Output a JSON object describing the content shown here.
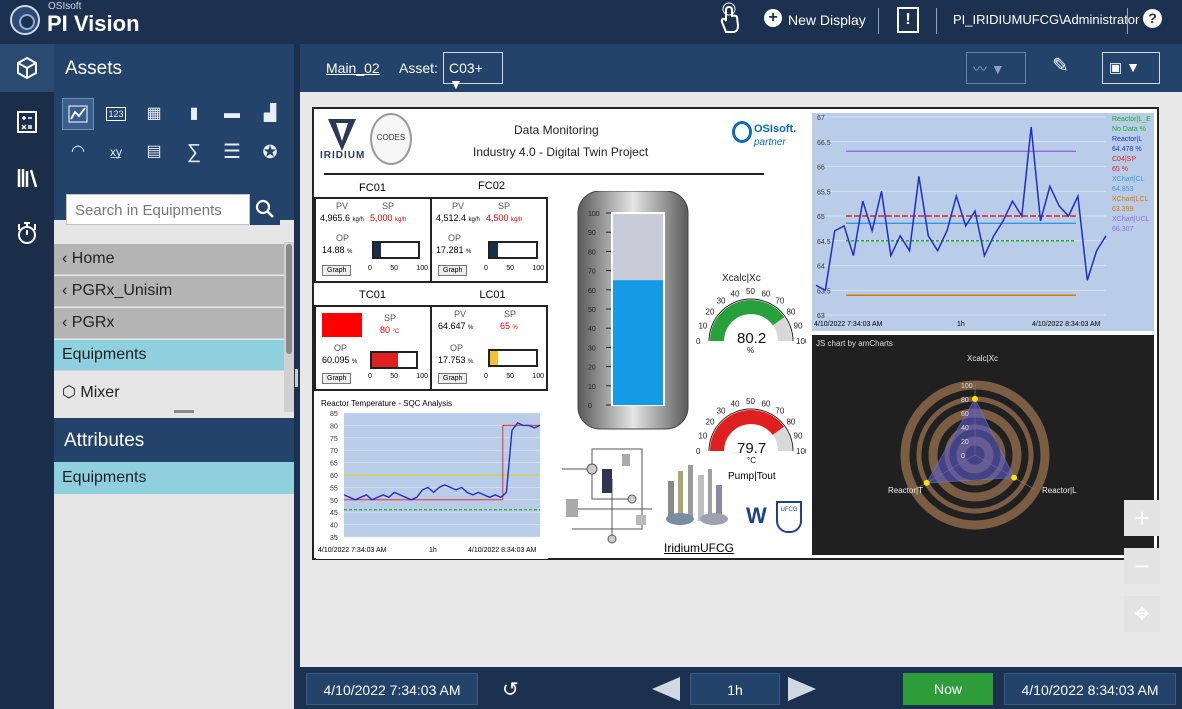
{
  "top": {
    "brand_sub": "OSIsoft",
    "brand": "PI Vision",
    "new_display": "New Display",
    "user": "PI_IRIDIUMUFCG\\Administrator"
  },
  "rail": {
    "icons": [
      "cube-icon",
      "calculator-icon",
      "library-icon",
      "stopwatch-icon"
    ]
  },
  "panel": {
    "title": "Assets",
    "search_placeholder": "Search in Equipments",
    "crumbs": [
      "Home",
      "PGRx_Unisim",
      "PGRx"
    ],
    "selected": "Equipments",
    "child": "Mixer",
    "attributes_title": "Attributes",
    "attributes_item": "Equipments"
  },
  "display": {
    "name": "Main_02",
    "asset_label": "Asset:",
    "asset_value": "C03+"
  },
  "canvas": {
    "header_line1": "Data Monitoring",
    "header_line2": "Industry 4.0 - Digital Twin Project",
    "iridium": "IRIDIUM",
    "codes": "CODES",
    "osi": "OSIsoft.",
    "osi_partner": "partner",
    "fc01": {
      "title": "FC01",
      "pv_label": "PV",
      "sp_label": "SP",
      "pv": "4,965.6",
      "pv_unit": "kg/h",
      "sp": "5,000",
      "sp_unit": "kg/h",
      "op_label": "OP",
      "op": "14.88",
      "op_unit": "%",
      "op_value": 14.88,
      "graph": "Graph",
      "ticks": [
        "0",
        "50",
        "100"
      ]
    },
    "fc02": {
      "title": "FC02",
      "pv_label": "PV",
      "sp_label": "SP",
      "pv": "4,512.4",
      "pv_unit": "kg/h",
      "sp": "4,500",
      "sp_unit": "kg/h",
      "op_label": "OP",
      "op": "17.281",
      "op_unit": "%",
      "op_value": 17.281,
      "graph": "Graph",
      "ticks": [
        "0",
        "50",
        "100"
      ]
    },
    "tc01": {
      "title": "TC01",
      "sp_label": "SP",
      "sp": "80",
      "sp_unit": "°C",
      "op_label": "OP",
      "op": "60.095",
      "op_unit": "%",
      "op_value": 60.095,
      "graph": "Graph",
      "ticks": [
        "0",
        "50",
        "100"
      ]
    },
    "lc01": {
      "title": "LC01",
      "pv_label": "PV",
      "sp_label": "SP",
      "pv": "64.647",
      "pv_unit": "%",
      "sp": "65",
      "sp_unit": "%",
      "op_label": "OP",
      "op": "17.753",
      "op_unit": "%",
      "op_value": 17.753,
      "graph": "Graph",
      "ticks": [
        "0",
        "50",
        "100"
      ]
    },
    "tank": {
      "level": 65,
      "ticks": [
        "100",
        "90",
        "80",
        "70",
        "60",
        "50",
        "40",
        "30",
        "20",
        "10",
        "0"
      ]
    },
    "gauge1": {
      "title": "Xcalc|Xc",
      "value": "80.2",
      "value_num": 80.2,
      "unit": "%",
      "ticks": [
        "0",
        "10",
        "20",
        "30",
        "40",
        "50",
        "60",
        "70",
        "80",
        "90",
        "100"
      ]
    },
    "gauge2": {
      "value": "79.7",
      "value_num": 79.7,
      "unit": "°C",
      "ticks": [
        "0",
        "10",
        "20",
        "30",
        "40",
        "50",
        "60",
        "70",
        "80",
        "90",
        "100"
      ]
    },
    "pump_label": "Pump|Tout",
    "link": "IridiumUFCG",
    "ufcg": "UFCG",
    "sqc": {
      "title": "Reactor Temperature - SQC Analysis",
      "y_ticks": [
        "85",
        "80",
        "75",
        "70",
        "65",
        "60",
        "55",
        "50",
        "45",
        "40",
        "35"
      ],
      "start": "4/10/2022 7:34:03 AM",
      "span": "1h",
      "end": "4/10/2022 8:34:03 AM"
    },
    "trend": {
      "y_ticks": [
        "67",
        "66.5",
        "66",
        "65.5",
        "65",
        "64.5",
        "64",
        "63.5",
        "63"
      ],
      "start": "4/10/2022 7:34:03 AM",
      "span": "1h",
      "end": "4/10/2022 8:34:03 AM",
      "legend": [
        {
          "name": "Reactor|L_E",
          "value": "No Data %",
          "color": "#22aa22"
        },
        {
          "name": "Reactor|L",
          "value": "64.478 %",
          "color": "#2233cc"
        },
        {
          "name": "C04|SP",
          "value": "65 %",
          "color": "#dd2222"
        },
        {
          "name": "XChart|CL",
          "value": "64.853",
          "color": "#3399dd"
        },
        {
          "name": "XChart|LCL",
          "value": "63.399",
          "color": "#dd7700"
        },
        {
          "name": "XChart|UCL",
          "value": "66.307",
          "color": "#9966dd"
        }
      ]
    },
    "radar": {
      "title": "JS chart by amCharts",
      "axis_label": "Xcalc|Xc",
      "left_label": "Reactor|T",
      "right_label": "Reactor|L",
      "ticks": [
        "100",
        "80",
        "60",
        "40",
        "20",
        "0"
      ]
    }
  },
  "chart_data": [
    {
      "type": "line",
      "title": "",
      "ylim": [
        63,
        67
      ],
      "x_start": "4/10/2022 7:34:03 AM",
      "x_end": "4/10/2022 8:34:03 AM",
      "series": [
        {
          "name": "Reactor|L",
          "values": [
            63.6,
            63.5,
            64.7,
            64.8,
            64.2,
            65.3,
            64.7,
            65.5,
            64.2,
            64.6,
            64.3,
            65.8,
            64.6,
            64.3,
            64.7,
            65.4,
            64.8,
            65.1,
            64.2,
            64.6,
            64.9,
            65.3,
            65.0,
            66.8,
            64.9,
            65.6,
            65.2,
            65.0,
            65.4,
            63.7,
            64.3,
            64.6
          ]
        },
        {
          "name": "C04|SP",
          "values": [
            65,
            65
          ]
        },
        {
          "name": "XChart|CL",
          "values": [
            64.853,
            64.853
          ]
        },
        {
          "name": "XChart|LCL",
          "values": [
            63.399,
            63.399
          ]
        },
        {
          "name": "XChart|UCL",
          "values": [
            66.307,
            66.307
          ]
        },
        {
          "name": "Reactor|L_E",
          "values": [
            64.5,
            64.5
          ]
        }
      ]
    },
    {
      "type": "line",
      "title": "Reactor Temperature - SQC Analysis",
      "ylim": [
        35,
        85
      ],
      "series": [
        {
          "values": [
            52,
            51,
            50,
            51,
            52,
            50,
            51,
            52,
            51,
            53,
            52,
            51,
            50,
            51,
            54,
            55,
            53,
            55,
            56,
            55,
            54,
            55,
            53,
            52,
            53,
            52,
            51,
            52,
            51,
            53,
            78,
            81,
            80,
            80,
            79,
            80
          ]
        }
      ]
    },
    {
      "type": "radar",
      "title": "JS chart by amCharts",
      "categories": [
        "Xcalc|Xc",
        "Reactor|L",
        "Reactor|T"
      ],
      "values": [
        80.2,
        64.5,
        79.7
      ]
    }
  ],
  "bottom": {
    "start": "4/10/2022 7:34:03 AM",
    "span": "1h",
    "now": "Now",
    "end": "4/10/2022 8:34:03 AM"
  }
}
